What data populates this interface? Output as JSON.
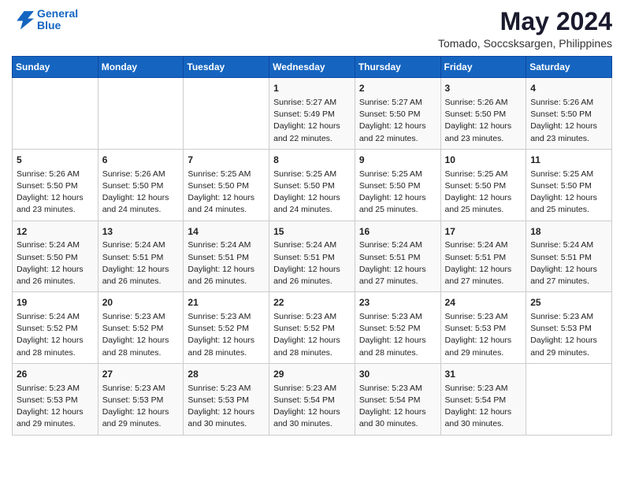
{
  "header": {
    "logo_line1": "General",
    "logo_line2": "Blue",
    "month": "May 2024",
    "location": "Tomado, Soccsksargen, Philippines"
  },
  "weekdays": [
    "Sunday",
    "Monday",
    "Tuesday",
    "Wednesday",
    "Thursday",
    "Friday",
    "Saturday"
  ],
  "rows": [
    [
      {
        "day": "",
        "info": ""
      },
      {
        "day": "",
        "info": ""
      },
      {
        "day": "",
        "info": ""
      },
      {
        "day": "1",
        "info": "Sunrise: 5:27 AM\nSunset: 5:49 PM\nDaylight: 12 hours\nand 22 minutes."
      },
      {
        "day": "2",
        "info": "Sunrise: 5:27 AM\nSunset: 5:50 PM\nDaylight: 12 hours\nand 22 minutes."
      },
      {
        "day": "3",
        "info": "Sunrise: 5:26 AM\nSunset: 5:50 PM\nDaylight: 12 hours\nand 23 minutes."
      },
      {
        "day": "4",
        "info": "Sunrise: 5:26 AM\nSunset: 5:50 PM\nDaylight: 12 hours\nand 23 minutes."
      }
    ],
    [
      {
        "day": "5",
        "info": "Sunrise: 5:26 AM\nSunset: 5:50 PM\nDaylight: 12 hours\nand 23 minutes."
      },
      {
        "day": "6",
        "info": "Sunrise: 5:26 AM\nSunset: 5:50 PM\nDaylight: 12 hours\nand 24 minutes."
      },
      {
        "day": "7",
        "info": "Sunrise: 5:25 AM\nSunset: 5:50 PM\nDaylight: 12 hours\nand 24 minutes."
      },
      {
        "day": "8",
        "info": "Sunrise: 5:25 AM\nSunset: 5:50 PM\nDaylight: 12 hours\nand 24 minutes."
      },
      {
        "day": "9",
        "info": "Sunrise: 5:25 AM\nSunset: 5:50 PM\nDaylight: 12 hours\nand 25 minutes."
      },
      {
        "day": "10",
        "info": "Sunrise: 5:25 AM\nSunset: 5:50 PM\nDaylight: 12 hours\nand 25 minutes."
      },
      {
        "day": "11",
        "info": "Sunrise: 5:25 AM\nSunset: 5:50 PM\nDaylight: 12 hours\nand 25 minutes."
      }
    ],
    [
      {
        "day": "12",
        "info": "Sunrise: 5:24 AM\nSunset: 5:50 PM\nDaylight: 12 hours\nand 26 minutes."
      },
      {
        "day": "13",
        "info": "Sunrise: 5:24 AM\nSunset: 5:51 PM\nDaylight: 12 hours\nand 26 minutes."
      },
      {
        "day": "14",
        "info": "Sunrise: 5:24 AM\nSunset: 5:51 PM\nDaylight: 12 hours\nand 26 minutes."
      },
      {
        "day": "15",
        "info": "Sunrise: 5:24 AM\nSunset: 5:51 PM\nDaylight: 12 hours\nand 26 minutes."
      },
      {
        "day": "16",
        "info": "Sunrise: 5:24 AM\nSunset: 5:51 PM\nDaylight: 12 hours\nand 27 minutes."
      },
      {
        "day": "17",
        "info": "Sunrise: 5:24 AM\nSunset: 5:51 PM\nDaylight: 12 hours\nand 27 minutes."
      },
      {
        "day": "18",
        "info": "Sunrise: 5:24 AM\nSunset: 5:51 PM\nDaylight: 12 hours\nand 27 minutes."
      }
    ],
    [
      {
        "day": "19",
        "info": "Sunrise: 5:24 AM\nSunset: 5:52 PM\nDaylight: 12 hours\nand 28 minutes."
      },
      {
        "day": "20",
        "info": "Sunrise: 5:23 AM\nSunset: 5:52 PM\nDaylight: 12 hours\nand 28 minutes."
      },
      {
        "day": "21",
        "info": "Sunrise: 5:23 AM\nSunset: 5:52 PM\nDaylight: 12 hours\nand 28 minutes."
      },
      {
        "day": "22",
        "info": "Sunrise: 5:23 AM\nSunset: 5:52 PM\nDaylight: 12 hours\nand 28 minutes."
      },
      {
        "day": "23",
        "info": "Sunrise: 5:23 AM\nSunset: 5:52 PM\nDaylight: 12 hours\nand 28 minutes."
      },
      {
        "day": "24",
        "info": "Sunrise: 5:23 AM\nSunset: 5:53 PM\nDaylight: 12 hours\nand 29 minutes."
      },
      {
        "day": "25",
        "info": "Sunrise: 5:23 AM\nSunset: 5:53 PM\nDaylight: 12 hours\nand 29 minutes."
      }
    ],
    [
      {
        "day": "26",
        "info": "Sunrise: 5:23 AM\nSunset: 5:53 PM\nDaylight: 12 hours\nand 29 minutes."
      },
      {
        "day": "27",
        "info": "Sunrise: 5:23 AM\nSunset: 5:53 PM\nDaylight: 12 hours\nand 29 minutes."
      },
      {
        "day": "28",
        "info": "Sunrise: 5:23 AM\nSunset: 5:53 PM\nDaylight: 12 hours\nand 30 minutes."
      },
      {
        "day": "29",
        "info": "Sunrise: 5:23 AM\nSunset: 5:54 PM\nDaylight: 12 hours\nand 30 minutes."
      },
      {
        "day": "30",
        "info": "Sunrise: 5:23 AM\nSunset: 5:54 PM\nDaylight: 12 hours\nand 30 minutes."
      },
      {
        "day": "31",
        "info": "Sunrise: 5:23 AM\nSunset: 5:54 PM\nDaylight: 12 hours\nand 30 minutes."
      },
      {
        "day": "",
        "info": ""
      }
    ]
  ]
}
